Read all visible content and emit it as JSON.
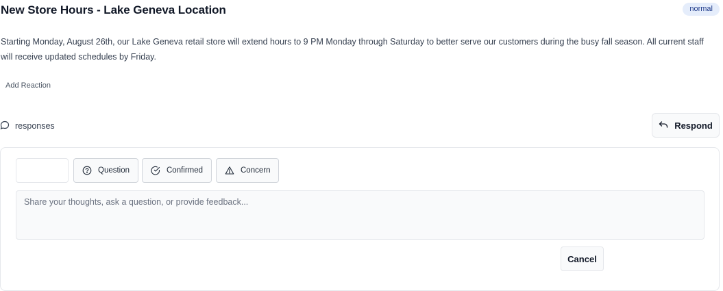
{
  "post": {
    "title": "New Store Hours - Lake Geneva Location",
    "priority_badge": "normal",
    "body": "Starting Monday, August 26th, our Lake Geneva retail store will extend hours to 9 PM Monday through Saturday to better serve our customers during the busy fall season. All current staff will receive updated schedules by Friday.",
    "add_reaction_label": "Add Reaction"
  },
  "responses": {
    "label": "responses",
    "respond_button_label": "Respond"
  },
  "reply_form": {
    "type_chips": [
      {
        "label": "Question",
        "icon": "question-circle-icon"
      },
      {
        "label": "Confirmed",
        "icon": "check-circle-icon"
      },
      {
        "label": "Concern",
        "icon": "warning-triangle-icon"
      }
    ],
    "textarea_placeholder": "Share your thoughts, ask a question, or provide feedback...",
    "cancel_label": "Cancel"
  },
  "colors": {
    "badge_bg": "#e5edfb",
    "badge_text": "#1e3a8a",
    "border": "#e5e7eb",
    "surface": "#f9fafb"
  }
}
